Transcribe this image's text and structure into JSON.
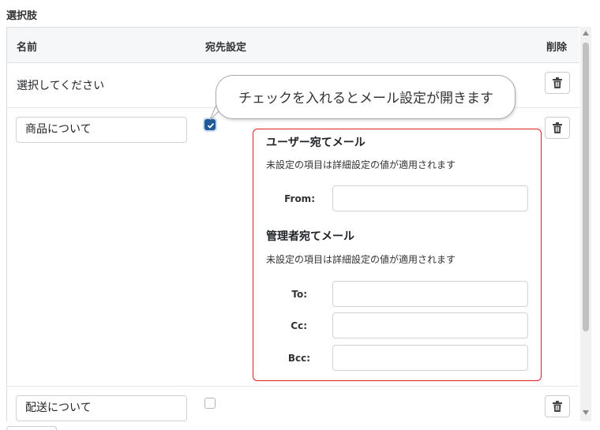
{
  "section": {
    "title": "選択肢"
  },
  "table": {
    "headers": {
      "name": "名前",
      "destination": "宛先設定",
      "delete": "削除"
    }
  },
  "rows": [
    {
      "name": "選択してください",
      "editable": false
    },
    {
      "name": "商品について",
      "editable": true,
      "destination_checked": true
    },
    {
      "name": "配送について",
      "editable": true,
      "destination_checked": false
    }
  ],
  "tooltip": {
    "text": "チェックを入れるとメール設定が開きます"
  },
  "mail_settings": {
    "user_mail": {
      "heading": "ユーザー宛てメール",
      "note": "未設定の項目は詳細設定の値が適用されます",
      "from_label": "From:",
      "from_value": ""
    },
    "admin_mail": {
      "heading": "管理者宛てメール",
      "note": "未設定の項目は詳細設定の値が適用されます",
      "to_label": "To:",
      "to_value": "",
      "cc_label": "Cc:",
      "cc_value": "",
      "bcc_label": "Bcc:",
      "bcc_value": ""
    }
  },
  "icons": {
    "delete": "trash-icon",
    "check": "check-icon"
  },
  "colors": {
    "accent": "#1f5a96",
    "highlight_border": "#e01e1e"
  }
}
